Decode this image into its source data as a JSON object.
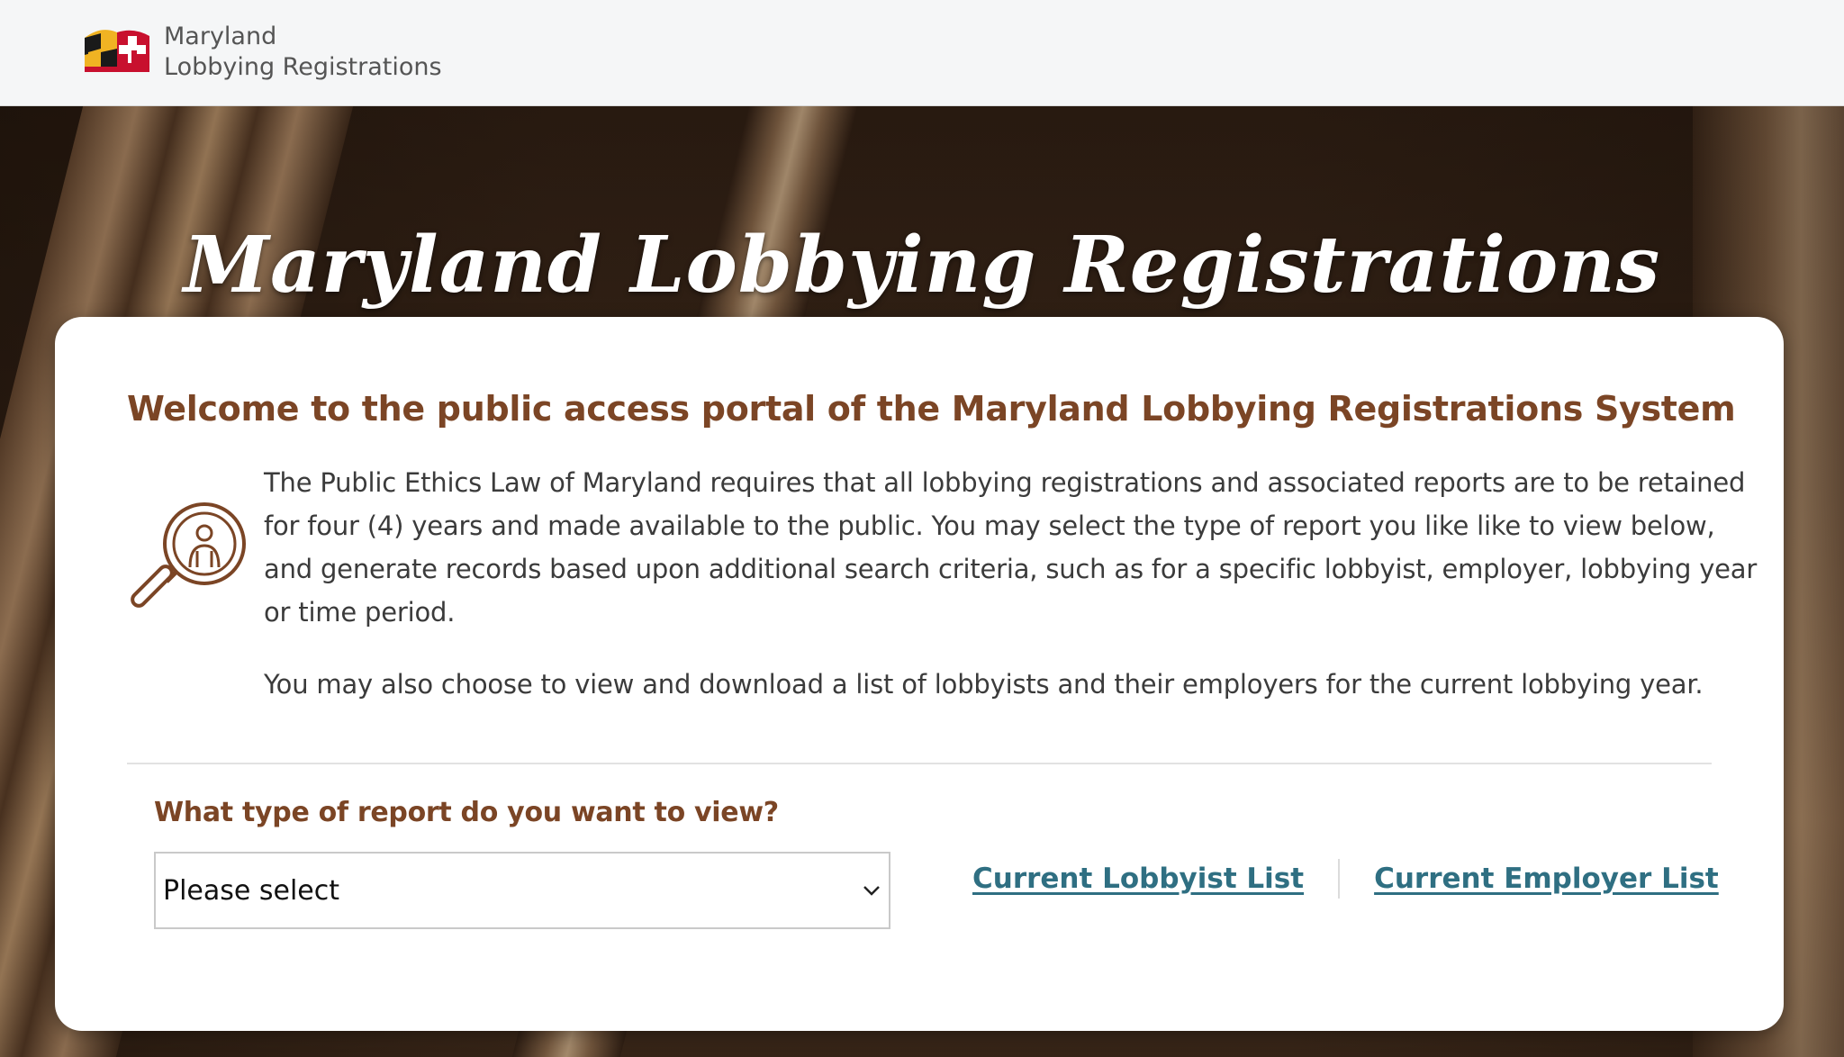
{
  "header": {
    "brand_line1": "Maryland",
    "brand_line2": "Lobbying Registrations"
  },
  "hero": {
    "title": "Maryland Lobbying Registrations"
  },
  "card": {
    "welcome_heading": "Welcome to the public access portal of the Maryland Lobbying Registrations System",
    "paragraph1": "The Public Ethics Law of Maryland requires that all lobbying registrations and associated reports are to be retained for four (4) years and made available to the public. You may select the type of report you like like to view below, and generate records based upon additional search criteria, such as for a specific lobbyist, employer, lobbying year or time period.",
    "paragraph2": "You may also choose to view and download a list of lobbyists and their employers for the current lobbying year.",
    "report_question": "What type of report do you want to view?",
    "report_select_value": "Please select",
    "links": {
      "lobbyist_list": "Current Lobbyist List",
      "employer_list": "Current Employer List"
    }
  },
  "colors": {
    "heading_brown": "#7b4525",
    "link_teal": "#2f6f82",
    "topbar_bg": "#f5f6f7",
    "flag_gold": "#f0b323",
    "flag_red": "#c8102e"
  },
  "icons": {
    "logo": "maryland-flag-logo",
    "intro": "magnifier-person-icon",
    "select": "chevron-down-icon"
  }
}
